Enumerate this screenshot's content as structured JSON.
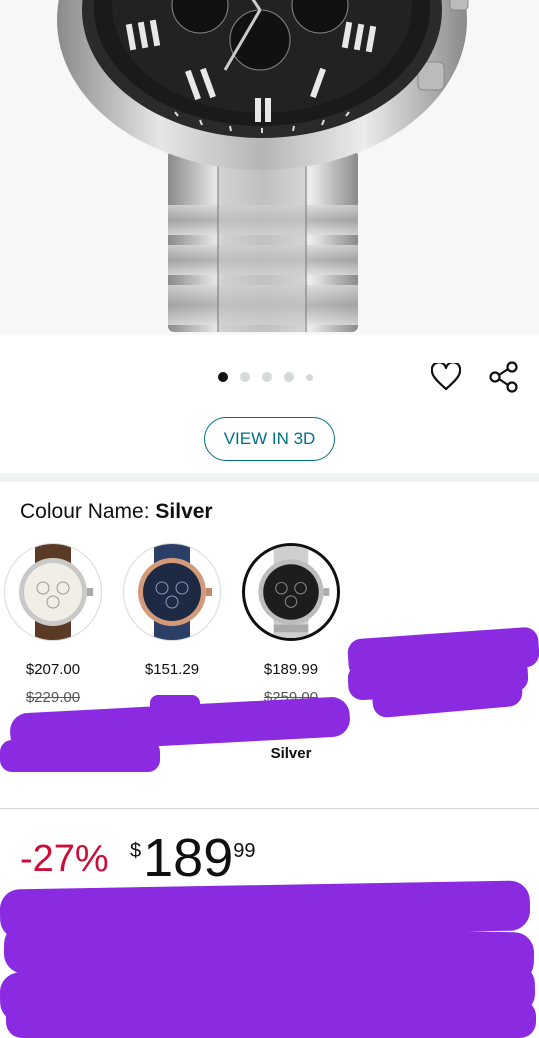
{
  "gallery": {
    "image_alt": "Fossil chronograph watch stainless steel silver",
    "dots_total": 5,
    "active_index": 0
  },
  "actions": {
    "favourite_icon": "heart-icon",
    "share_icon": "share-icon",
    "view_3d_label": "VIEW IN 3D"
  },
  "colour": {
    "label_prefix": "Colour Name: ",
    "selected_name": "Silver"
  },
  "swatches": [
    {
      "price": "$207.00",
      "list_price": "$229.00",
      "name": "",
      "variant": "brown-leather-white-dial",
      "selected": false
    },
    {
      "price": "$151.29",
      "list_price": "",
      "name": "",
      "variant": "blue-leather-rose-gold",
      "selected": false
    },
    {
      "price": "$189.99",
      "list_price": "$259.00",
      "name": "Silver",
      "variant": "silver-steel-black-dial",
      "selected": true
    }
  ],
  "pricing": {
    "discount": "-27%",
    "currency_symbol": "$",
    "whole": "189",
    "fraction": "99"
  },
  "colors": {
    "link": "#007185",
    "deal": "#cc0c39",
    "redaction": "#8a2be2"
  }
}
